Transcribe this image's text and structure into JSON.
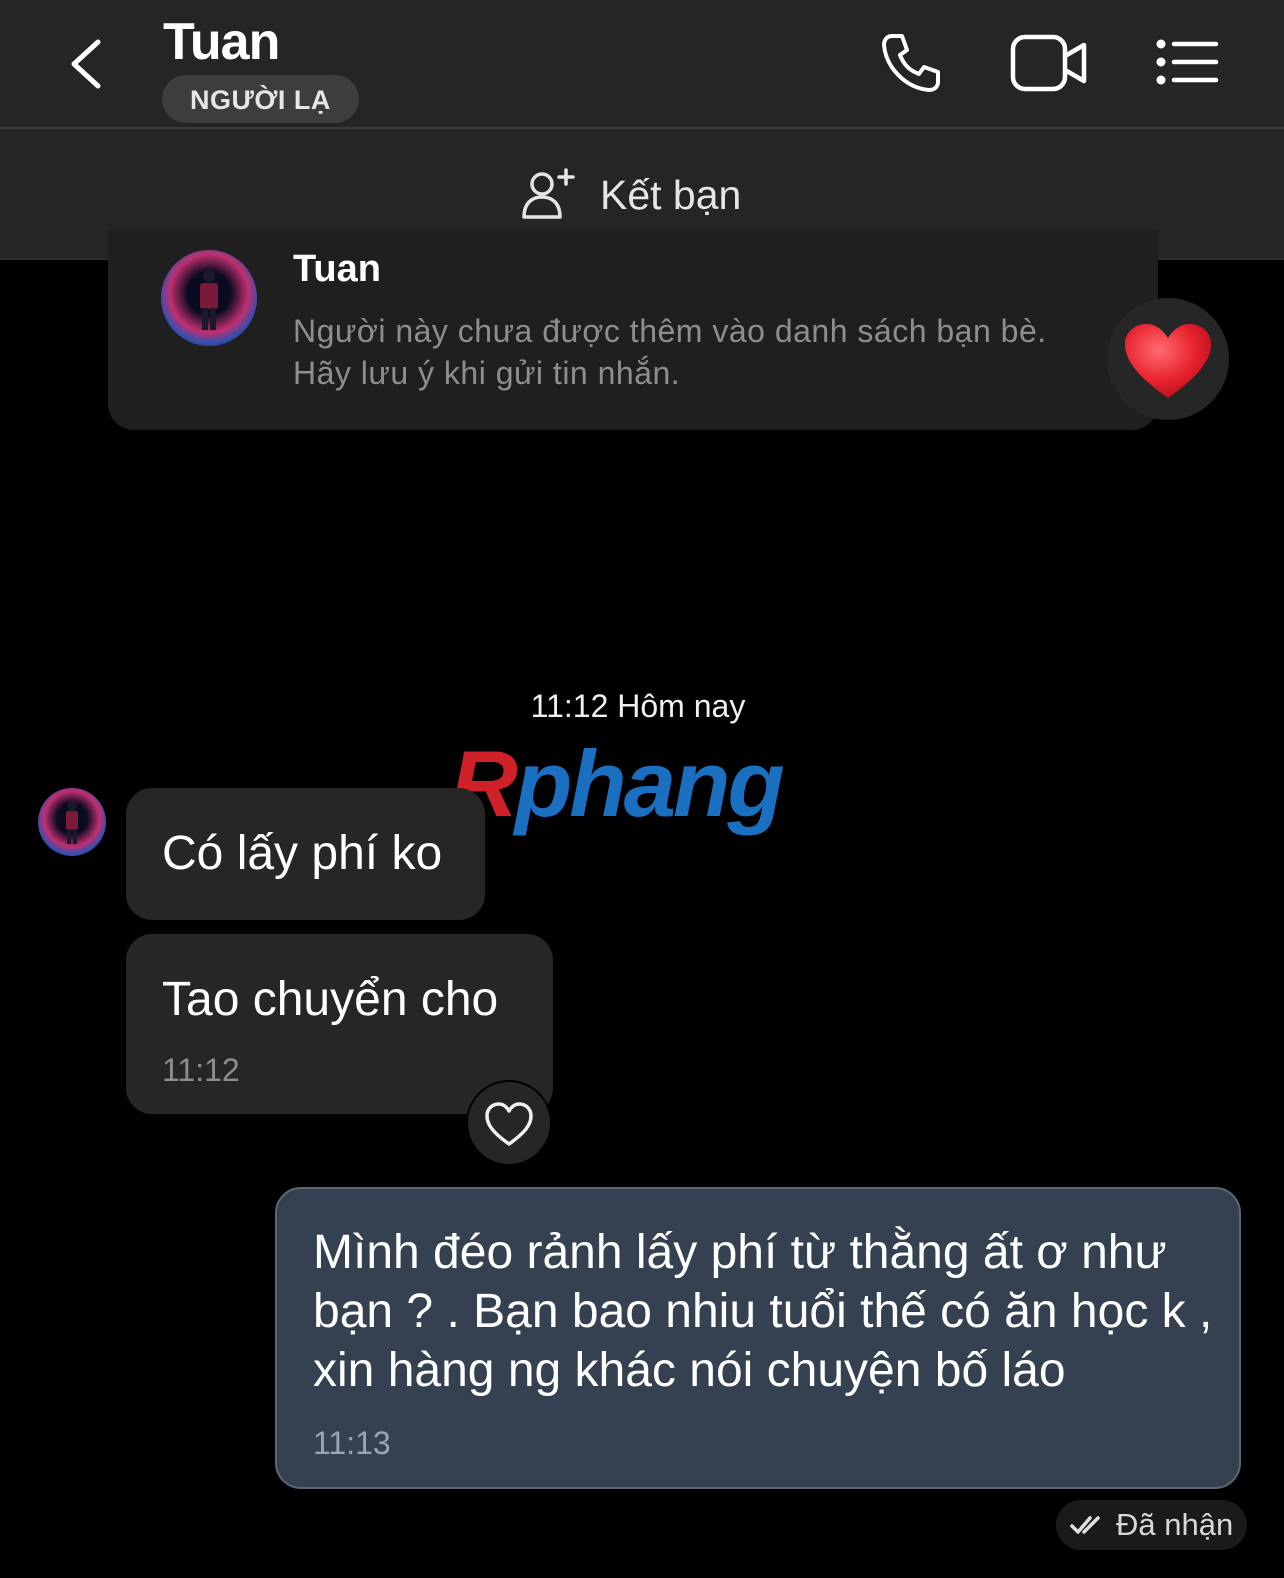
{
  "header": {
    "title": "Tuan",
    "badge": "NGƯỜI LẠ"
  },
  "friend_bar": {
    "label": "Kết bạn"
  },
  "info_card": {
    "name": "Tuan",
    "text": "Người này chưa được thêm vào danh sách bạn bè. Hãy lưu ý khi gửi tin nhắn."
  },
  "conversation": {
    "timestamp": "11:12 Hôm nay",
    "watermark": "Rphang",
    "incoming": [
      {
        "text": "Có lấy phí ko"
      },
      {
        "text": "Tao chuyển cho",
        "time": "11:12"
      }
    ],
    "outgoing": {
      "text": "Mình đéo rảnh lấy phí từ thằng ất ơ như bạn ? . Bạn bao nhiu tuổi thế có ăn học k , xin hàng ng khác nói chuyện bố láo",
      "time": "11:13",
      "status": "Đã nhận"
    }
  },
  "colors": {
    "header_bg": "#252525",
    "incoming_bubble": "#262626",
    "outgoing_bubble": "#354150",
    "reaction_heart": "#e8222e"
  }
}
